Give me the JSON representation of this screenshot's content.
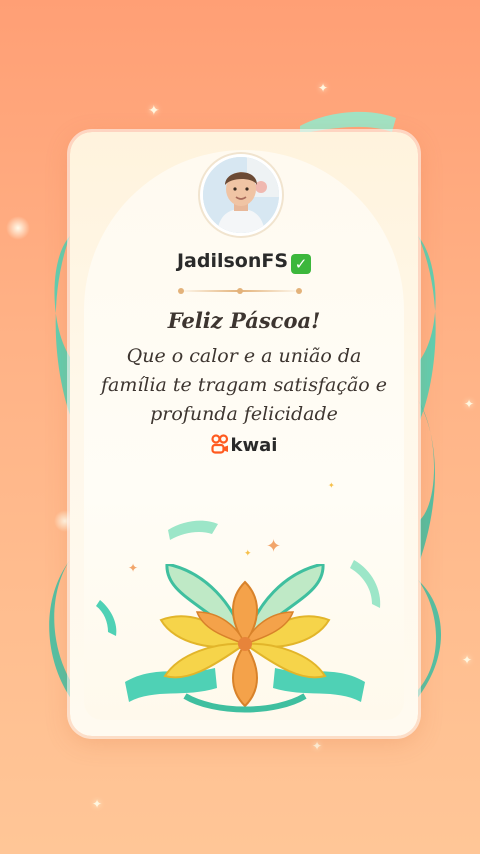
{
  "card": {
    "username": "JadilsonFS",
    "verified_mark": "✓",
    "greeting_title": "Feliz Páscoa!",
    "greeting_lines": [
      "Que o calor e a união da",
      "família te tragam satisfação e",
      "profunda felicidade"
    ],
    "brand_name": "kwai"
  },
  "icons": {
    "avatar": "user-avatar-photo",
    "verified": "check-badge-icon",
    "brand_logo": "kwai-logo-icon",
    "decoration": "flower-ribbon-illustration"
  },
  "colors": {
    "background_top": "#ff9f75",
    "background_bottom": "#ffc697",
    "card": "#fff8ea",
    "verified_green": "#3cb73c",
    "brand_orange": "#ff5a1f",
    "ribbon_teal": "#4fd1b5",
    "petal_yellow": "#f6d44a",
    "petal_orange": "#f4a24a"
  }
}
